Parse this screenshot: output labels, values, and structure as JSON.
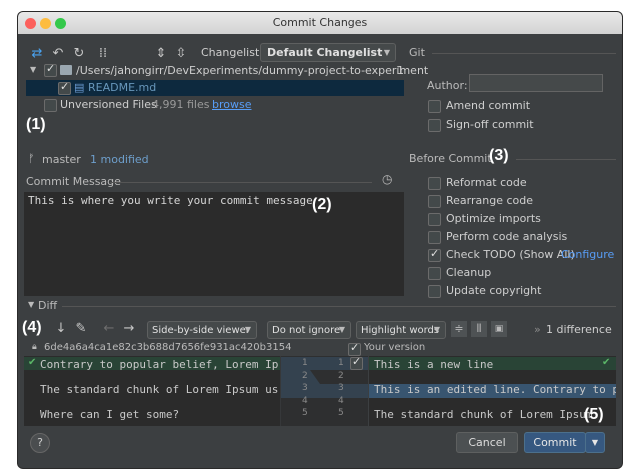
{
  "window": {
    "title": "Commit Changes"
  },
  "toolbar": {
    "changelist_label": "Changelist:",
    "changelist_value": "Default Changelist"
  },
  "changes": {
    "root_path": "/Users/jahongirr/DevExperiments/dummy-project-to-experiment",
    "root_count": "1",
    "file": "README.md",
    "unversioned_label": "Unversioned Files",
    "unversioned_count": "4,991 files",
    "browse_link": "browse"
  },
  "status": {
    "branch": "master",
    "modified": "1 modified"
  },
  "commit_message": {
    "label": "Commit Message",
    "text": "This is where you write your commit message"
  },
  "git": {
    "section": "Git",
    "author_label": "Author:",
    "author_value": "",
    "amend": "Amend commit",
    "signoff": "Sign-off commit"
  },
  "before_commit": {
    "section": "Before Commit",
    "items": [
      {
        "label": "Reformat code",
        "checked": false
      },
      {
        "label": "Rearrange code",
        "checked": false
      },
      {
        "label": "Optimize imports",
        "checked": false
      },
      {
        "label": "Perform code analysis",
        "checked": false
      },
      {
        "label": "Check TODO (Show All)",
        "checked": true
      },
      {
        "label": "Cleanup",
        "checked": false
      },
      {
        "label": "Update copyright",
        "checked": false
      }
    ],
    "configure_link": "Configure"
  },
  "diff": {
    "section": "Diff",
    "viewer": "Side-by-side viewer",
    "ignore": "Do not ignore",
    "highlight": "Highlight words",
    "difference_count": "1 difference",
    "left_header": "6de4a6a4ca1e82c3b688d7656fe931ac420b3154",
    "right_header": "Your version",
    "left_lines": [
      "Contrary to popular belief, Lorem Ip",
      "",
      "The standard chunk of Lorem Ipsum us",
      "",
      "Where can I get some?"
    ],
    "right_lines": [
      "This is a new line",
      "",
      "This is an edited line. Contrary to po",
      "",
      "The standard chunk of Lorem Ipsum"
    ],
    "left_nums": [
      "1",
      "2",
      "3",
      "4",
      "5"
    ],
    "right_nums": [
      "1",
      "2",
      "3",
      "4",
      "5"
    ]
  },
  "buttons": {
    "help": "?",
    "cancel": "Cancel",
    "commit": "Commit"
  },
  "callouts": {
    "c1": "(1)",
    "c2": "(2)",
    "c3": "(3)",
    "c4": "(4)",
    "c5": "(5)"
  },
  "colors": {
    "accent": "#4b6eaf",
    "link": "#589df6",
    "added": "#294436",
    "changed": "#385570"
  }
}
